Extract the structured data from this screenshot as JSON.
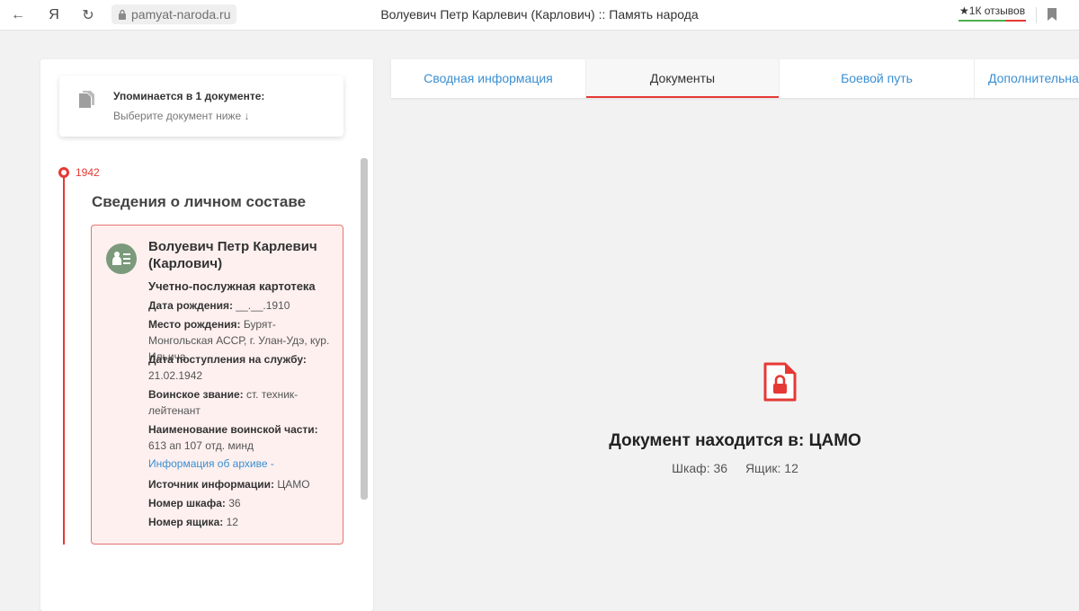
{
  "browser": {
    "back_glyph": "←",
    "yandex_glyph": "Я",
    "reload_glyph": "↻",
    "url": "pamyat-naroda.ru",
    "page_title": "Волуевич Петр Карлевич (Карлович) :: Память народа",
    "reviews_star": "★",
    "reviews_label": "1К отзывов"
  },
  "sidebar": {
    "mention_title": "Упоминается в 1 документе:",
    "mention_subtitle": "Выберите документ ниже ↓",
    "year": "1942",
    "section_title": "Сведения о личном составе",
    "record": {
      "name": "Волуевич Петр Карлевич (Карлович)",
      "type": "Учетно-послужная картотека",
      "birth_date_label": "Дата рождения:",
      "birth_date_value": "__.__.1910",
      "birth_place_label": "Место рождения:",
      "birth_place_value": "Бурят-Монгольская АССР, г. Улан-Удэ, кур. Ильича",
      "service_start_label": "Дата поступления на службу:",
      "service_start_value": "21.02.1942",
      "rank_label": "Воинское звание:",
      "rank_value": "ст. техник-лейтенант",
      "unit_label": "Наименование воинской части:",
      "unit_value": "613 ап 107 отд. минд",
      "archive_link": "Информация об архиве -",
      "source_label": "Источник информации:",
      "source_value": "ЦАМО",
      "cabinet_label": "Номер шкафа:",
      "cabinet_value": "36",
      "box_label": "Номер ящика:",
      "box_value": "12"
    }
  },
  "tabs": [
    {
      "label": "Сводная информация",
      "active": false
    },
    {
      "label": "Документы",
      "active": true
    },
    {
      "label": "Боевой путь",
      "active": false
    },
    {
      "label": "Дополнительная",
      "active": false
    }
  ],
  "document": {
    "location": "Документ находится в: ЦАМО",
    "cabinet": "Шкаф: 36",
    "box": "Ящик: 12"
  },
  "colors": {
    "accent_red": "#e53935",
    "link_blue": "#3b8fd1",
    "avatar_green": "#7b9a7b"
  }
}
